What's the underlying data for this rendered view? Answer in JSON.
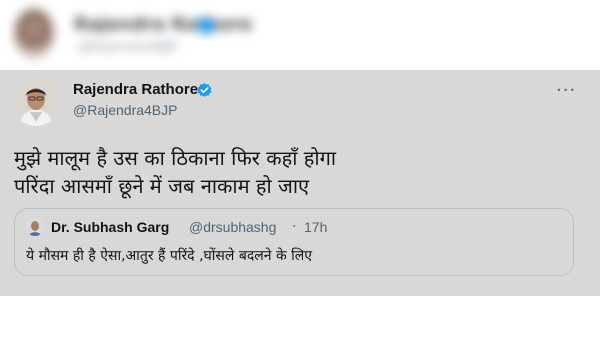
{
  "background_tweet": {
    "name": "Rajendra Rathore",
    "handle": "@Rajendra4BJP"
  },
  "tweet": {
    "author_name": "Rajendra Rathore",
    "author_handle": "@Rajendra4BJP",
    "more_label": "···",
    "text_line1": "मुझे मालूम है उस का ठिकाना फिर कहाँ होगा",
    "text_line2": "परिंदा आसमाँ छूने में जब नाकाम हो जाए",
    "verified_color": "#1d9bf0"
  },
  "quoted_tweet": {
    "author_name": "Dr. Subhash Garg",
    "author_handle": "@drsubhashg",
    "separator": "·",
    "time": "17h",
    "text": "ये मौसम ही है ऐसा,आतुर हैं परिंदे ,घोंसले बदलने के लिए"
  }
}
